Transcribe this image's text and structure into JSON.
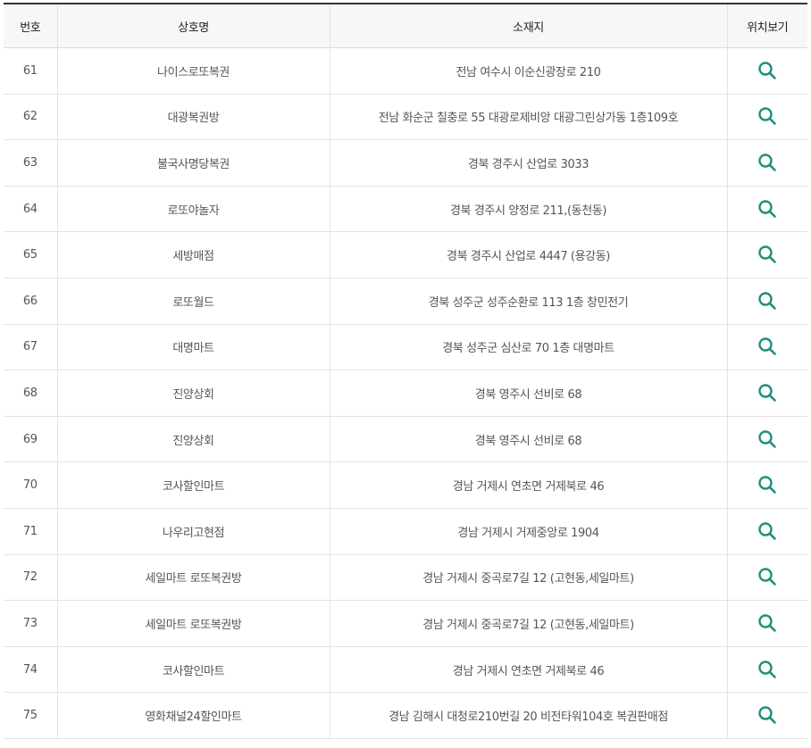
{
  "table": {
    "headers": {
      "no": "번호",
      "name": "상호명",
      "address": "소재지",
      "map": "위치보기"
    },
    "rows": [
      {
        "no": "61",
        "name": "나이스로또복권",
        "address": "전남 여수시 이순신광장로 210"
      },
      {
        "no": "62",
        "name": "대광복권방",
        "address": "전남 화순군 칠충로 55 대광로제비앙 대광그린상가동 1층109호"
      },
      {
        "no": "63",
        "name": "불국사명당복권",
        "address": "경북 경주시 산업로 3033"
      },
      {
        "no": "64",
        "name": "로또야놀자",
        "address": "경북 경주시 양정로 211,(동천동)"
      },
      {
        "no": "65",
        "name": "세방매점",
        "address": "경북 경주시 산업로 4447 (용강동)"
      },
      {
        "no": "66",
        "name": "로또월드",
        "address": "경북 성주군 성주순환로 113 1층 창민전기"
      },
      {
        "no": "67",
        "name": "대명마트",
        "address": "경북 성주군 심산로 70 1층 대명마트"
      },
      {
        "no": "68",
        "name": "진양상회",
        "address": "경북 영주시 선비로 68"
      },
      {
        "no": "69",
        "name": "진양상회",
        "address": "경북 영주시 선비로 68"
      },
      {
        "no": "70",
        "name": "코사할인마트",
        "address": "경남 거제시 연초면 거제북로 46"
      },
      {
        "no": "71",
        "name": "나우리고현점",
        "address": "경남 거제시 거제중앙로 1904"
      },
      {
        "no": "72",
        "name": "세일마트 로또복권방",
        "address": "경남 거제시 중곡로7길 12 (고현동,세일마트)"
      },
      {
        "no": "73",
        "name": "세일마트 로또복권방",
        "address": "경남 거제시 중곡로7길 12 (고현동,세일마트)"
      },
      {
        "no": "74",
        "name": "코사할인마트",
        "address": "경남 거제시 연초면 거제북로 46"
      },
      {
        "no": "75",
        "name": "영화채널24할인마트",
        "address": "경남 김해시 대청로210번길 20 비전타워104호 복권판매점"
      }
    ],
    "map_icon": "search-icon",
    "accent_color": "#1f8f7a"
  }
}
